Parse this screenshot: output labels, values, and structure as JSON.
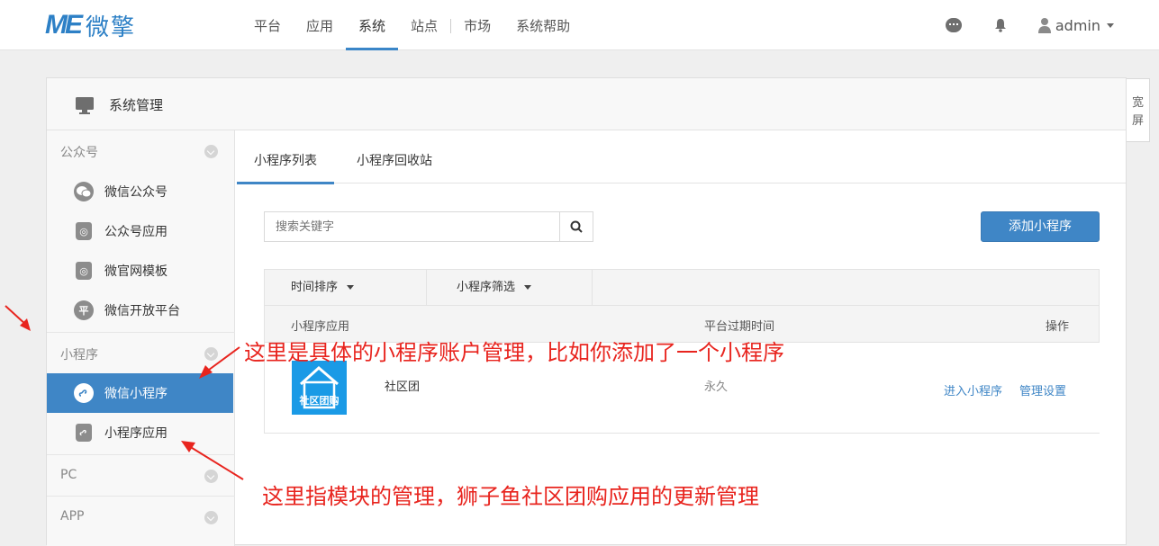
{
  "header": {
    "logo_mark": "ME",
    "logo_text": "微擎",
    "nav": [
      "平台",
      "应用",
      "系统",
      "站点",
      "市场",
      "系统帮助"
    ],
    "active_nav": "系统",
    "user": "admin",
    "icons": [
      "chat-icon",
      "bell-icon",
      "user-icon",
      "caret-down-icon"
    ]
  },
  "card": {
    "title": "系统管理"
  },
  "wide_toggle": "宽屏",
  "sidebar": {
    "group1": "公众号",
    "group1_items": [
      "微信公众号",
      "公众号应用",
      "微官网模板",
      "微信开放平台"
    ],
    "badge_ping": "平",
    "group2": "小程序",
    "group2_items": [
      "微信小程序",
      "小程序应用"
    ],
    "active_item": "微信小程序",
    "group3": "PC",
    "group4": "APP"
  },
  "tabs": [
    "小程序列表",
    "小程序回收站"
  ],
  "search": {
    "placeholder": "搜索关键字"
  },
  "add_button": "添加小程序",
  "filters": [
    "时间排序",
    "小程序筛选"
  ],
  "table": {
    "headers": [
      "小程序应用",
      "平台过期时间",
      "操作"
    ],
    "rows": [
      {
        "logo_text": "社区团购",
        "name": "社区团",
        "expire": "永久",
        "actions": [
          "进入小程序",
          "管理设置"
        ]
      }
    ]
  },
  "annotations": {
    "top": "这里是具体的小程序账户管理，比如你添加了一个小程序",
    "bottom": "这里指模块的管理，狮子鱼社区团购应用的更新管理"
  },
  "colors": {
    "accent": "#3f86c6",
    "annotation": "#e8241e",
    "app_logo": "#1a9ae6"
  }
}
